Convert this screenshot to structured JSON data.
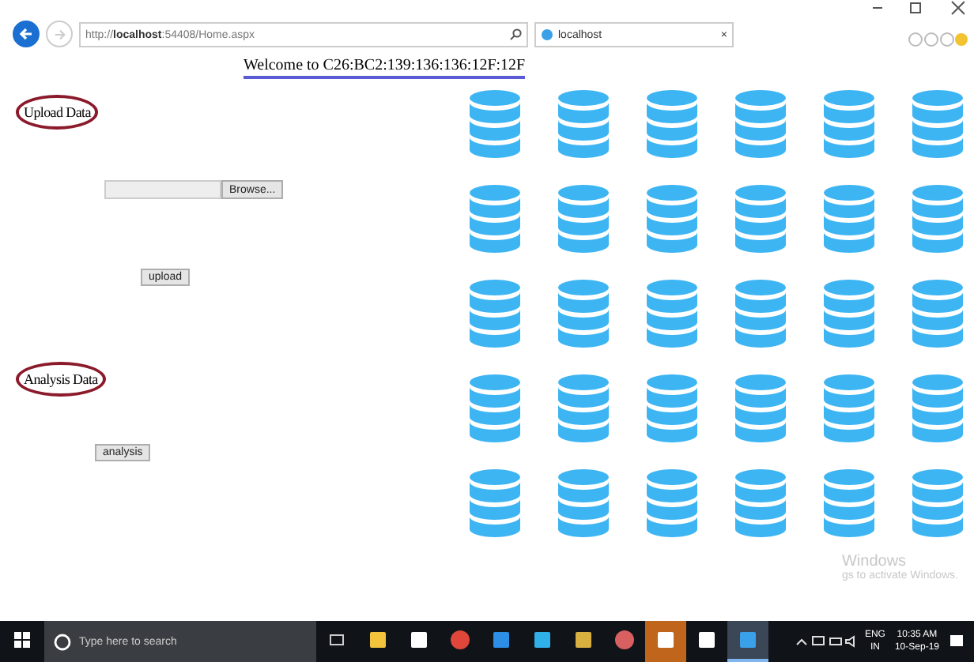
{
  "browser": {
    "address_scheme": "http://",
    "address_host": "localhost",
    "address_rest": ":54408/Home.aspx",
    "tab_title": "localhost",
    "tab_close": "×"
  },
  "page": {
    "heading": "Welcome to C26:BC2:139:136:136:12F:12F",
    "sections": [
      {
        "kind": "upload",
        "title": "Upload Data",
        "browse_label": "Browse...",
        "button": "upload"
      },
      {
        "kind": "analysis",
        "title": "Analysis Data",
        "button": "analysis"
      }
    ]
  },
  "activation_notice": {
    "title": "Windows",
    "line": "gs to activate Windows."
  },
  "taskbar": {
    "search_placeholder": "Type here to search",
    "apps": [
      {
        "kind": "explorer",
        "selected": false
      },
      {
        "kind": "store",
        "selected": false
      },
      {
        "kind": "chrome",
        "selected": false
      },
      {
        "kind": "edge",
        "selected": false
      },
      {
        "kind": "remote",
        "selected": false
      },
      {
        "kind": "tool",
        "selected": false
      },
      {
        "kind": "paint",
        "selected": false
      },
      {
        "kind": "studio",
        "selected": false
      },
      {
        "kind": "photos",
        "selected": false
      },
      {
        "kind": "ie",
        "selected": true
      }
    ],
    "language": "ENG",
    "region": "IN",
    "time": "10:35 AM",
    "date": "10-Sep-19"
  }
}
